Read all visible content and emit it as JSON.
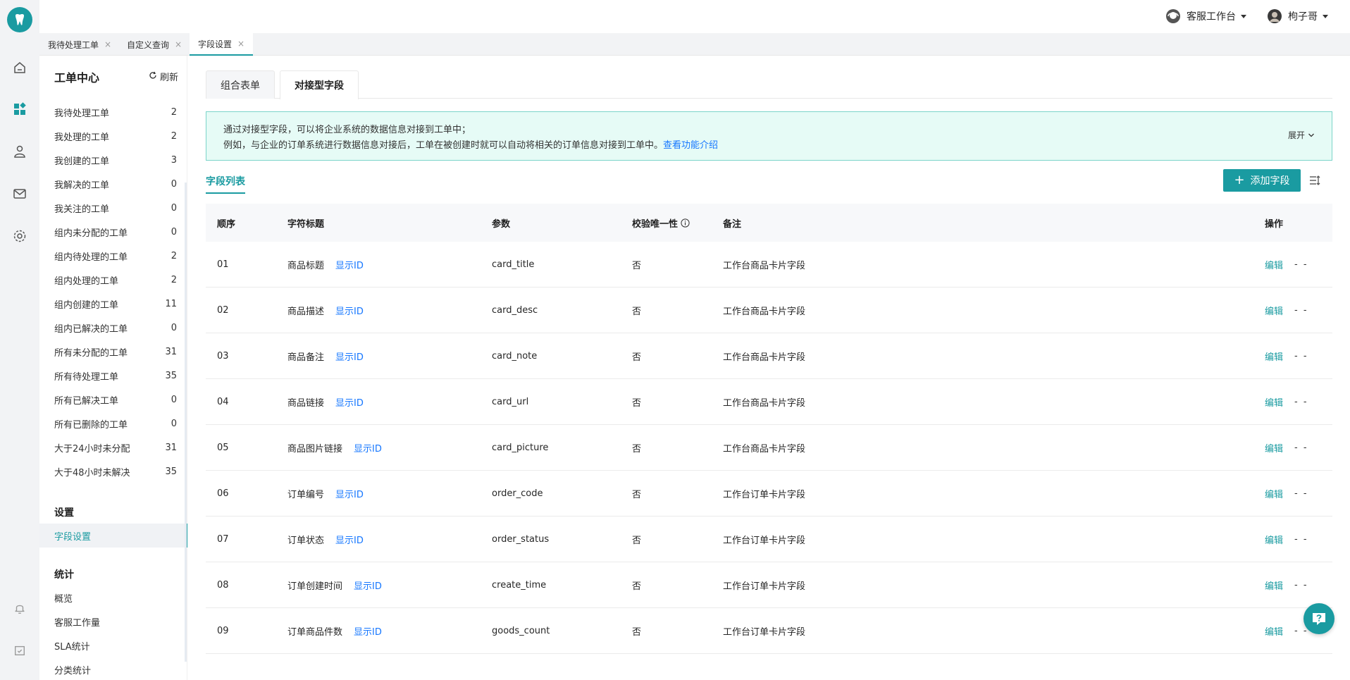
{
  "colors": {
    "accent": "#1a9ba1",
    "link": "#1677ff",
    "notice_bg": "#e6fbf6"
  },
  "rail": {
    "icons": [
      "tooth-logo-icon",
      "home-icon",
      "dashboard-icon",
      "user-icon",
      "mail-icon",
      "settings-icon",
      "bell-icon",
      "calendar-icon"
    ]
  },
  "header": {
    "workspace_label": "客服工作台",
    "user_name": "枸子哥"
  },
  "page_tabs": [
    {
      "label": "我待处理工单",
      "close": "×"
    },
    {
      "label": "自定义查询",
      "close": "×"
    },
    {
      "label": "字段设置",
      "close": "×"
    }
  ],
  "sidebar": {
    "title": "工单中心",
    "refresh_label": "刷新",
    "items": [
      {
        "label": "我待处理工单",
        "count": "2"
      },
      {
        "label": "我处理的工单",
        "count": "2"
      },
      {
        "label": "我创建的工单",
        "count": "3"
      },
      {
        "label": "我解决的工单",
        "count": "0"
      },
      {
        "label": "我关注的工单",
        "count": "0"
      },
      {
        "label": "组内未分配的工单",
        "count": "0"
      },
      {
        "label": "组内待处理的工单",
        "count": "2"
      },
      {
        "label": "组内处理的工单",
        "count": "2"
      },
      {
        "label": "组内创建的工单",
        "count": "11"
      },
      {
        "label": "组内已解决的工单",
        "count": "0"
      },
      {
        "label": "所有未分配的工单",
        "count": "31"
      },
      {
        "label": "所有待处理工单",
        "count": "35"
      },
      {
        "label": "所有已解决工单",
        "count": "0"
      },
      {
        "label": "所有已删除的工单",
        "count": "0"
      },
      {
        "label": "大于24小时未分配",
        "count": "31"
      },
      {
        "label": "大于48小时未解决",
        "count": "35"
      }
    ],
    "settings_head": "设置",
    "settings_item": "字段设置",
    "stats_head": "统计",
    "stats_items": [
      "概览",
      "客服工作量",
      "SLA统计",
      "分类统计"
    ]
  },
  "main": {
    "tabs": [
      "组合表单",
      "对接型字段"
    ],
    "notice": {
      "line1": "通过对接型字段，可以将企业系统的数据信息对接到工单中；",
      "line2": "例如，与企业的订单系统进行数据信息对接后，工单在被创建时就可以自动将相关的订单信息对接到工单中。",
      "link": "查看功能介绍",
      "expand": "展开"
    },
    "list_tab": "字段列表",
    "add_button": "添加字段",
    "table": {
      "headers": {
        "seq": "顺序",
        "title": "字符标题",
        "param": "参数",
        "unique": "校验唯一性",
        "note": "备注",
        "op": "操作"
      },
      "show_id": "显示ID",
      "edit": "编辑",
      "dash": "- -",
      "rows": [
        {
          "seq": "01",
          "title": "商品标题",
          "param": "card_title",
          "unique": "否",
          "note": "工作台商品卡片字段"
        },
        {
          "seq": "02",
          "title": "商品描述",
          "param": "card_desc",
          "unique": "否",
          "note": "工作台商品卡片字段"
        },
        {
          "seq": "03",
          "title": "商品备注",
          "param": "card_note",
          "unique": "否",
          "note": "工作台商品卡片字段"
        },
        {
          "seq": "04",
          "title": "商品链接",
          "param": "card_url",
          "unique": "否",
          "note": "工作台商品卡片字段"
        },
        {
          "seq": "05",
          "title": "商品图片链接",
          "param": "card_picture",
          "unique": "否",
          "note": "工作台商品卡片字段"
        },
        {
          "seq": "06",
          "title": "订单编号",
          "param": "order_code",
          "unique": "否",
          "note": "工作台订单卡片字段"
        },
        {
          "seq": "07",
          "title": "订单状态",
          "param": "order_status",
          "unique": "否",
          "note": "工作台订单卡片字段"
        },
        {
          "seq": "08",
          "title": "订单创建时间",
          "param": "create_time",
          "unique": "否",
          "note": "工作台订单卡片字段"
        },
        {
          "seq": "09",
          "title": "订单商品件数",
          "param": "goods_count",
          "unique": "否",
          "note": "工作台订单卡片字段"
        }
      ]
    }
  }
}
